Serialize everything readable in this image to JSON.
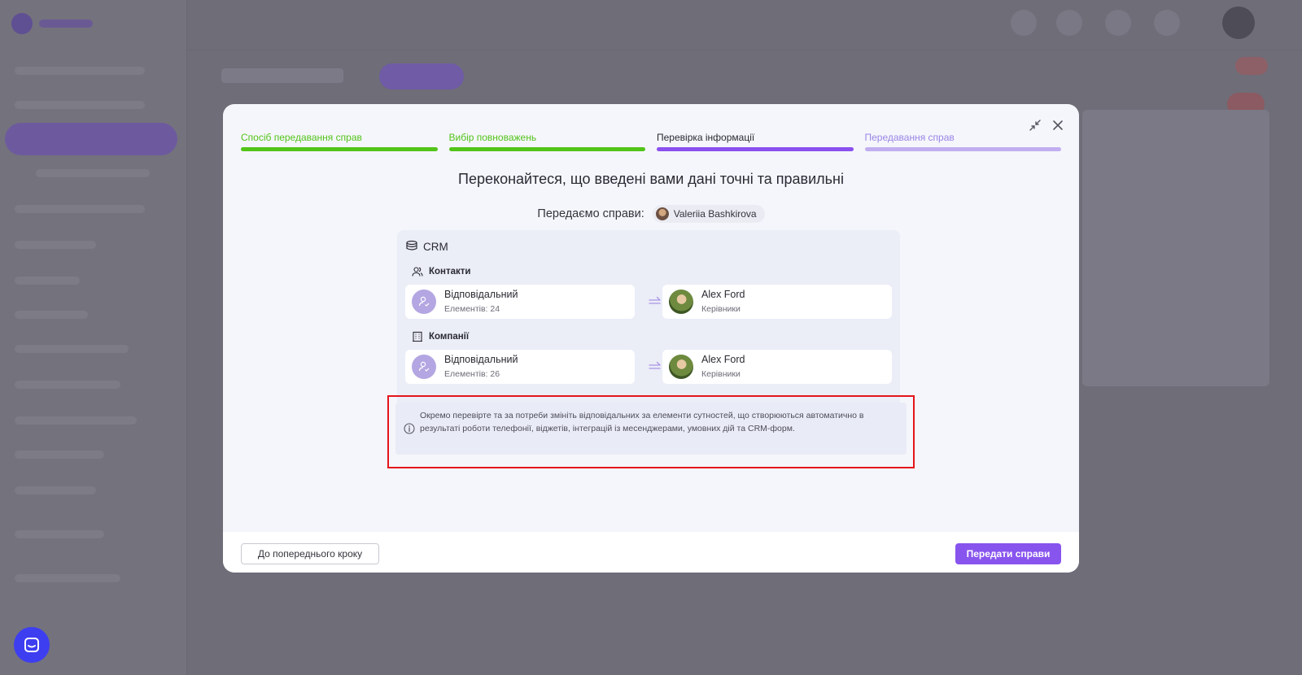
{
  "stepper": {
    "steps": [
      {
        "label": "Спосіб передавання справ",
        "state": "done"
      },
      {
        "label": "Вибір повноважень",
        "state": "done"
      },
      {
        "label": "Перевірка інформації",
        "state": "active"
      },
      {
        "label": "Передавання справ",
        "state": "upcoming"
      }
    ],
    "colors": {
      "done": "#52c41a",
      "active": "#8a51ef",
      "upcoming": "#c1aef0",
      "upcoming_text": "#9a84e6"
    }
  },
  "review": {
    "heading": "Переконайтеся, що введені вами дані точні та правильні",
    "transfer_label": "Передаємо справи:",
    "transfer_user": "Valeriia Bashkirova"
  },
  "crm": {
    "title": "CRM",
    "sections": [
      {
        "title": "Контакти",
        "icon": "users-icon",
        "from": {
          "label": "Відповідальний",
          "count": "Елементів: 24"
        },
        "to": {
          "name": "Alex Ford",
          "role": "Керівники"
        }
      },
      {
        "title": "Компанії",
        "icon": "building-icon",
        "from": {
          "label": "Відповідальний",
          "count": "Елементів: 26"
        },
        "to": {
          "name": "Alex Ford",
          "role": "Керівники"
        }
      }
    ]
  },
  "notice": {
    "text": "Окремо перевірте та за потреби змініть відповідальних за елементи сутностей, що створюються автоматично в результаті роботи телефонії, віджетів, інтеграцій із месенджерами, умовних дій та CRM-форм."
  },
  "footer": {
    "back_label": "До попереднього кроку",
    "submit_label": "Передати справи"
  },
  "colors": {
    "accent": "#8854ee",
    "highlight": "#e5141c"
  }
}
